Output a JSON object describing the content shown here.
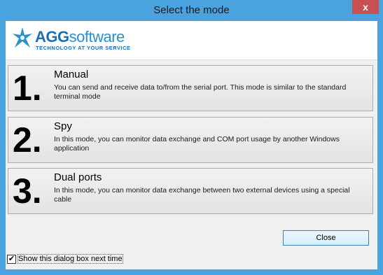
{
  "window": {
    "title": "Select the mode",
    "close_glyph": "x",
    "accent": "#4aa3df"
  },
  "logo": {
    "name_a": "AGG",
    "name_b": "software",
    "tagline": "TECHNOLOGY AT YOUR SERVICE"
  },
  "modes": [
    {
      "number": "1.",
      "title": "Manual",
      "desc": "You can send and receive data to/from the serial port. This mode is similar to the standard terminal mode"
    },
    {
      "number": "2.",
      "title": "Spy",
      "desc": "In this mode, you can monitor data exchange and COM port usage by another Windows application"
    },
    {
      "number": "3.",
      "title": "Dual ports",
      "desc": "In this mode, you can monitor data exchange between two external devices using a special cable"
    }
  ],
  "buttons": {
    "close": "Close"
  },
  "footer": {
    "show_dialog_label": "Show this dialog box next time",
    "checked_glyph": "✔"
  }
}
